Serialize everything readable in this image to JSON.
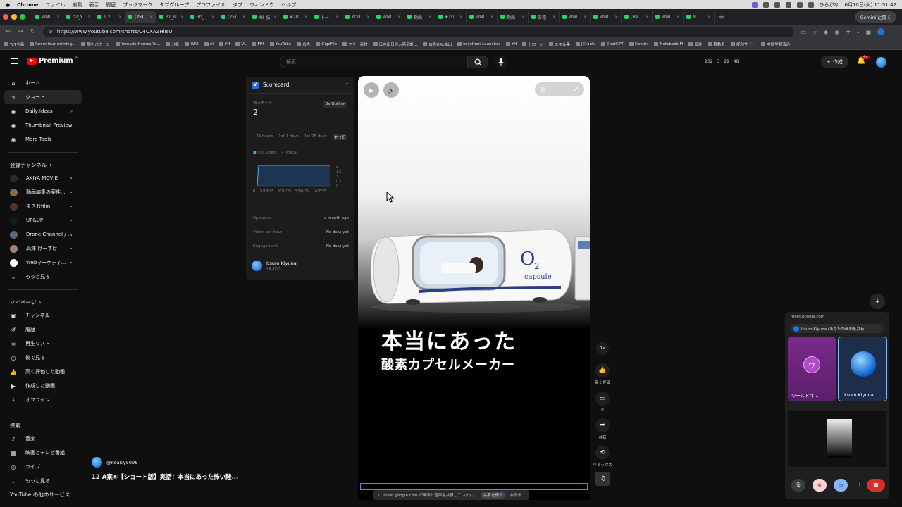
{
  "menubar": {
    "app": "Chrome",
    "items": [
      "ファイル",
      "編集",
      "表示",
      "履歴",
      "ブックマーク",
      "タブグループ",
      "プロファイル",
      "タブ",
      "ウィンドウ",
      "ヘルプ"
    ],
    "clock": "6月10日(火) 11:51:42",
    "user": "ひらがな"
  },
  "tabs": [
    {
      "label": "WNI",
      "active": false
    },
    {
      "label": "02_Y",
      "active": false
    },
    {
      "label": "1 2",
      "active": false
    },
    {
      "label": "(25)",
      "active": true
    },
    {
      "label": "31_ill",
      "active": false
    },
    {
      "label": "30_",
      "active": false
    },
    {
      "label": "(25)",
      "active": false
    },
    {
      "label": "49_抜",
      "active": false
    },
    {
      "label": "#20",
      "active": false
    },
    {
      "label": "トー",
      "active": false
    },
    {
      "label": "YOU",
      "active": false
    },
    {
      "label": "WNI",
      "active": false
    },
    {
      "label": "動画",
      "active": false
    },
    {
      "label": "★20",
      "active": false
    },
    {
      "label": "WNI",
      "active": false
    },
    {
      "label": "動画",
      "active": false
    },
    {
      "label": "各種",
      "active": false
    },
    {
      "label": "WNI",
      "active": false
    },
    {
      "label": "WNI",
      "active": false
    },
    {
      "label": "[He",
      "active": false
    },
    {
      "label": "WNI",
      "active": false
    },
    {
      "label": "M",
      "active": false
    }
  ],
  "gemini_button": "Gemini に聞く",
  "address": {
    "url": "https://www.youtube.com/shorts/O4CXAZHiIsU"
  },
  "bookmarks": [
    "ToT全画",
    "Room tour winning...",
    "腕もバターン",
    "Yamada Homes Yo...",
    "分析",
    "WNI",
    "AI",
    "YH",
    "VL",
    "MM",
    "YouTube",
    "広告",
    "GigaFile",
    "フリー素材",
    "日の出日の入時刻計...",
    "広告URL抽出",
    "keychron Launcher",
    "YH",
    "ドローン",
    "スキル集",
    "JGrants",
    "ChatGPT",
    "Gemini",
    "Notebook M",
    "音楽",
    "稼動者",
    "便利サイト",
    "中間学習済み"
  ],
  "youtube": {
    "logo": "Premium",
    "logo_region": "JP",
    "search_placeholder": "検索",
    "stats": {
      "a": "202",
      "b": "3",
      "c": "29",
      "d": "48"
    },
    "create_label": "作成",
    "bell_badge": "9+"
  },
  "sidebar": {
    "main": [
      {
        "label": "ホーム",
        "icon": "home-icon"
      },
      {
        "label": "ショート",
        "icon": "shorts-icon",
        "active": true
      },
      {
        "label": "Daily Ideas",
        "icon": "ideas-icon",
        "external": true
      },
      {
        "label": "Thumbnail Preview",
        "icon": "thumbnail-icon"
      },
      {
        "label": "More Tools",
        "icon": "tools-icon"
      }
    ],
    "subs_header": "登録チャンネル",
    "subs": [
      {
        "label": "AKIYA MOVIE",
        "color": "#2a2a2a"
      },
      {
        "label": "動画編集の案件...",
        "color": "#8a6a4a"
      },
      {
        "label": "まきおfilm",
        "color": "#553333"
      },
      {
        "label": "UP&UP",
        "color": "#1a1a1a"
      },
      {
        "label": "Drone Channel / ...",
        "color": "#5a6a7a"
      },
      {
        "label": "高澤 けーすけ",
        "color": "#a08070"
      },
      {
        "label": "Webマーケティ...",
        "color": "#ffffff"
      }
    ],
    "subs_more": "もっと見る",
    "you_header": "マイページ",
    "you": [
      {
        "label": "チャンネル",
        "icon": "channel-icon"
      },
      {
        "label": "履歴",
        "icon": "history-icon"
      },
      {
        "label": "再生リスト",
        "icon": "playlist-icon"
      },
      {
        "label": "後で見る",
        "icon": "watch-later-icon"
      },
      {
        "label": "高く評価した動画",
        "icon": "liked-icon"
      },
      {
        "label": "作成した動画",
        "icon": "your-videos-icon"
      },
      {
        "label": "オフライン",
        "icon": "download-icon"
      }
    ],
    "explore_header": "探索",
    "explore": [
      {
        "label": "音楽",
        "icon": "music-icon"
      },
      {
        "label": "映画とテレビ番組",
        "icon": "movies-icon"
      },
      {
        "label": "ライブ",
        "icon": "live-icon"
      }
    ],
    "explore_more": "もっと見る",
    "more_services": "YouTube の他のサービス"
  },
  "scorecard": {
    "title": "Scorecard",
    "mode_label": "表示モード",
    "mode_value": "2",
    "outlier": "2x Outlier",
    "ranges": [
      "24 hours",
      "1st 7 days",
      "1st 28 days",
      "すべて"
    ],
    "active_range": "すべて",
    "legend": [
      "This video",
      "Typical"
    ],
    "chart_x": [
      "5/18/25",
      "5/20/25",
      "5/30/25",
      "6/7/25"
    ],
    "chart_y": [
      "2",
      "1.5",
      "1",
      "0.5",
      "0"
    ],
    "chart_y0": "0",
    "uploaded_label": "Uploaded",
    "uploaded_value": "a month ago",
    "vph_label": "Views per hour",
    "vph_value": "No data yet",
    "engagement_label": "Engagement",
    "engagement_value": "No data yet",
    "channel_name": "Itsuro Kiyuna",
    "channel_subs": "49.3万人"
  },
  "video": {
    "brand": "capsule",
    "title_jp": "本当にあった",
    "subtitle_jp": "酸素カプセルメーカー",
    "share_text": "meet.google.com が画面と音声を共有しています。",
    "share_stop": "共有を停止",
    "share_hide": "非表示"
  },
  "actions": {
    "speed": "1x",
    "like_label": "高く評価",
    "comment_count": "0",
    "share_label": "共有",
    "remix_label": "リミックス"
  },
  "owner": {
    "handle": "@itsukiy5096",
    "title": "12 A案⑥【ショート版】実話！本当にあった怖い酸..."
  },
  "meet": {
    "url": "meet.google.com",
    "share_notice": "Itsuro Kiyuna (あなたが画面を共有...",
    "tile1_letter": "ワ",
    "tile1_name": "ワールドネ...",
    "tile2_name": "Itsuro Kiyuna"
  },
  "colors": {
    "accent": "#ff0000",
    "link": "#3ea6ff",
    "meet_purple": "#7b2a8c",
    "meet_blue": "#8ab4f8",
    "end_call": "#d93025"
  }
}
